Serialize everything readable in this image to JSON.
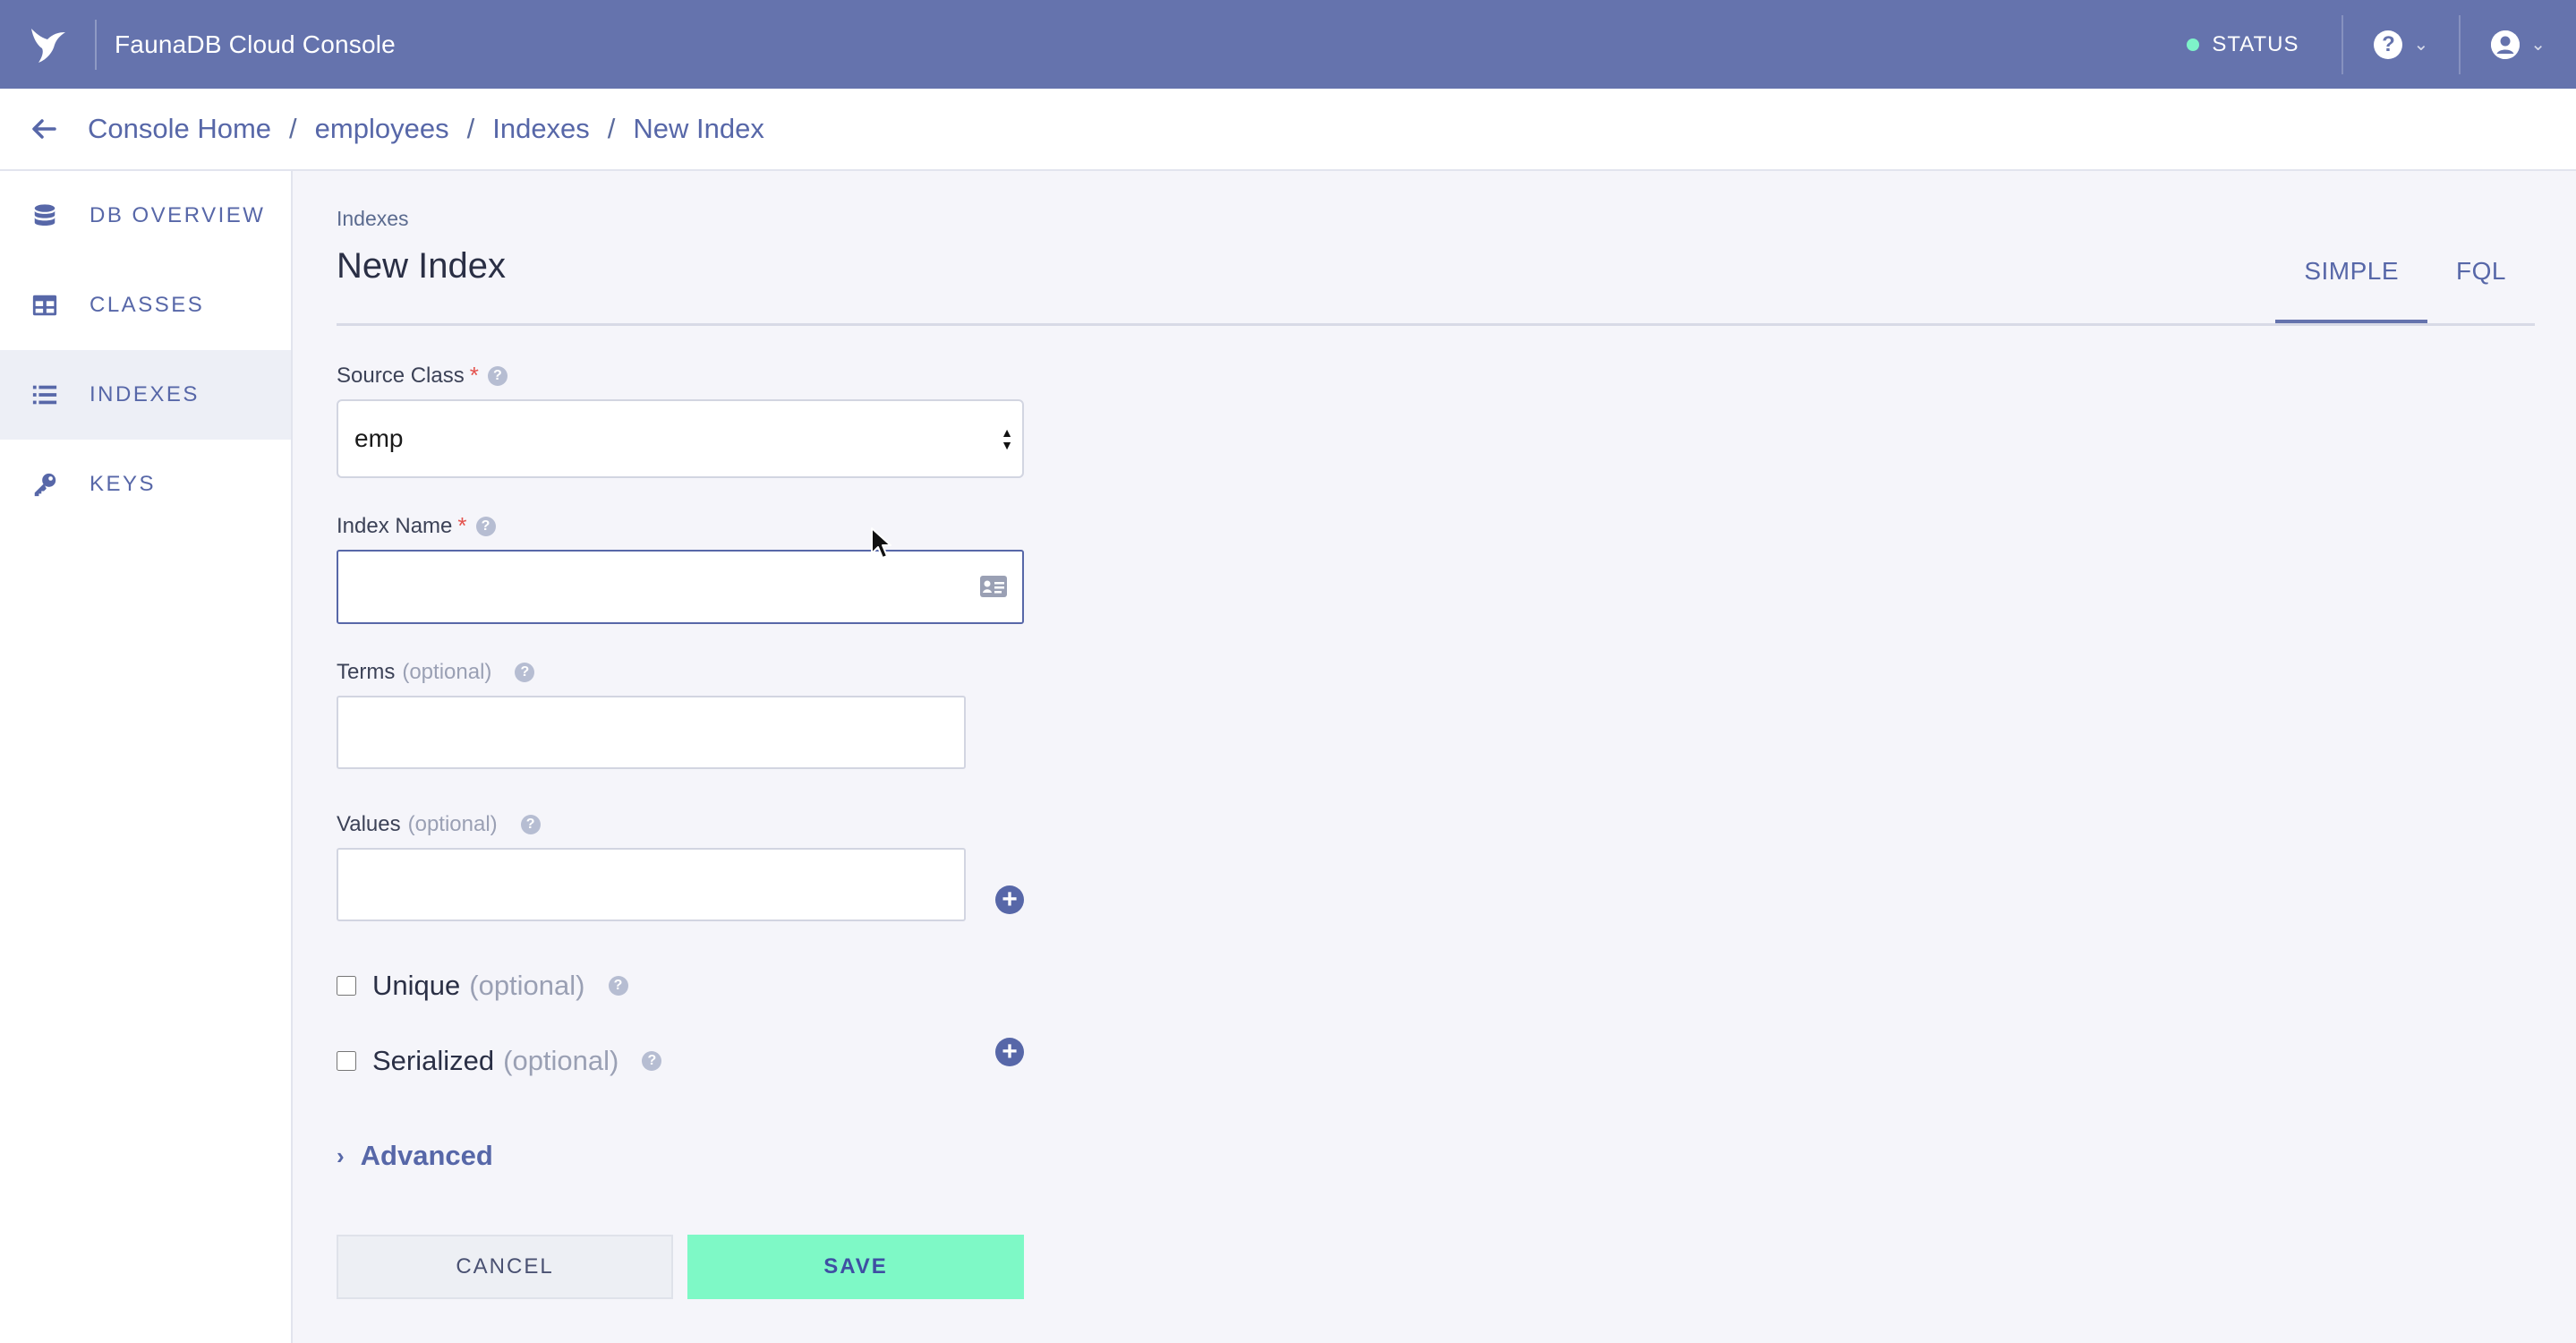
{
  "app": {
    "title": "FaunaDB Cloud Console"
  },
  "topbar": {
    "status_label": "STATUS",
    "help_glyph": "?"
  },
  "breadcrumb": [
    "Console Home",
    "employees",
    "Indexes",
    "New Index"
  ],
  "sidebar": {
    "items": [
      {
        "label": "DB OVERVIEW",
        "icon": "database-icon"
      },
      {
        "label": "CLASSES",
        "icon": "table-icon"
      },
      {
        "label": "INDEXES",
        "icon": "list-icon",
        "active": true
      },
      {
        "label": "KEYS",
        "icon": "key-icon"
      }
    ]
  },
  "page": {
    "eyebrow": "Indexes",
    "title": "New Index"
  },
  "tabs": [
    {
      "label": "SIMPLE",
      "active": true
    },
    {
      "label": "FQL"
    }
  ],
  "form": {
    "source_class": {
      "label": "Source Class",
      "value": "emp"
    },
    "index_name": {
      "label": "Index Name",
      "value": ""
    },
    "terms": {
      "label": "Terms",
      "optional": "(optional)",
      "value": ""
    },
    "values": {
      "label": "Values",
      "optional": "(optional)",
      "value": ""
    },
    "unique": {
      "label": "Unique",
      "optional": "(optional)",
      "checked": false
    },
    "serialized": {
      "label": "Serialized",
      "optional": "(optional)",
      "checked": false
    },
    "advanced_label": "Advanced",
    "required_mark": "*",
    "help_glyph": "?"
  },
  "actions": {
    "cancel_label": "CANCEL",
    "save_label": "SAVE"
  },
  "colors": {
    "topbar": "#6573ad",
    "accent": "#5767a8",
    "save": "#7ef9c6",
    "status_dot": "#7ef3c9",
    "required": "#e4524d"
  }
}
